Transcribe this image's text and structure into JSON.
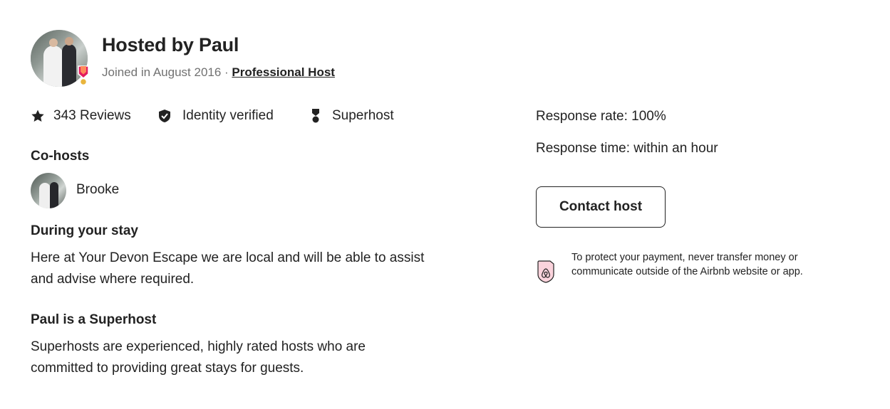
{
  "host": {
    "title": "Hosted by Paul",
    "joined": "Joined in August 2016 · ",
    "professional_label": "Professional Host"
  },
  "stats": [
    {
      "icon": "star-icon",
      "label": "343 Reviews"
    },
    {
      "icon": "verified-shield-icon",
      "label": "Identity verified"
    },
    {
      "icon": "superhost-medal-icon",
      "label": "Superhost"
    }
  ],
  "cohosts": {
    "heading": "Co-hosts",
    "items": [
      {
        "name": "Brooke"
      }
    ]
  },
  "during_stay": {
    "heading": "During your stay",
    "text": "Here at Your Devon Escape we are local and will be able to assist and advise where required."
  },
  "superhost": {
    "heading": "Paul is a Superhost",
    "text": "Superhosts are experienced, highly rated hosts who are committed to providing great stays for guests."
  },
  "response": {
    "rate": "Response rate: 100%",
    "time": "Response time: within an hour"
  },
  "contact": {
    "button_label": "Contact host"
  },
  "protection": {
    "icon": "payment-protection-icon",
    "text": "To protect your payment, never transfer money or communicate outside of the Airbnb website or app."
  },
  "colors": {
    "text": "#222222",
    "muted": "#717171",
    "brand": "#ff385c",
    "badge_pink": "#e31c5f"
  }
}
